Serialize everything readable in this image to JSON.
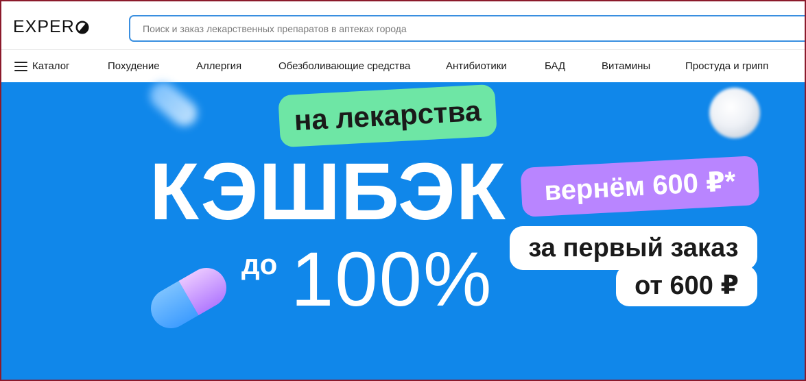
{
  "header": {
    "logo_text": "EXPER",
    "search": {
      "placeholder": "Поиск и заказ лекарственных препаратов в аптеках города",
      "value": ""
    }
  },
  "nav": {
    "catalog_label": "Каталог",
    "items": [
      {
        "label": "Похудение"
      },
      {
        "label": "Аллергия"
      },
      {
        "label": "Обезболивающие средства"
      },
      {
        "label": "Антибиотики"
      },
      {
        "label": "БАД"
      },
      {
        "label": "Витамины"
      },
      {
        "label": "Простуда и грипп"
      }
    ]
  },
  "banner": {
    "tag_medicines": "на лекарства",
    "headline": "КЭШБЭК",
    "up_to": "до",
    "percent": "100%",
    "cashback_amount": "вернём 600 ₽*",
    "first_order": "за первый заказ",
    "min_order": "от 600 ₽"
  },
  "colors": {
    "banner_bg": "#1087ea",
    "green_tag": "#6ee6a5",
    "purple_tag": "#b985ff",
    "search_border": "#3a8fe0"
  }
}
